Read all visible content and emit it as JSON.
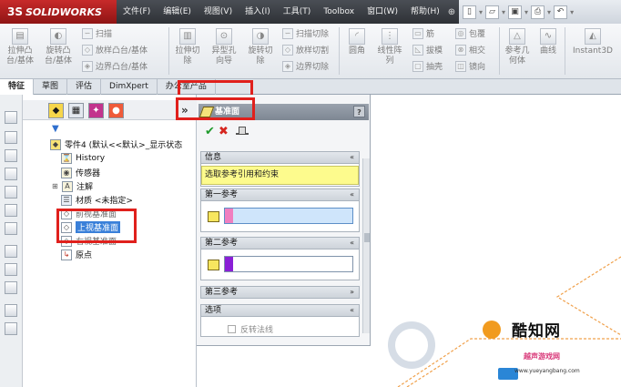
{
  "app": {
    "logo_text": "SOLIDWORKS",
    "logo_mark": "3S"
  },
  "menu": [
    "文件(F)",
    "编辑(E)",
    "视图(V)",
    "插入(I)",
    "工具(T)",
    "Toolbox",
    "窗口(W)",
    "帮助(H)"
  ],
  "command_manager": {
    "boss_extrude": "拉伸凸\n台/基体",
    "revolve_boss": "旋转凸\n台/基体",
    "sweep": "扫描",
    "loft_boss": "放样凸台/基体",
    "boundary_boss": "边界凸台/基体",
    "extrude_cut": "拉伸切\n除",
    "hole_wizard": "异型孔\n向导",
    "revolve_cut": "旋转切\n除",
    "swept_cut": "扫描切除",
    "lofted_cut": "放样切割",
    "boundary_cut": "边界切除",
    "fillet": "圆角",
    "linear_pattern": "线性阵\n列",
    "rib": "筋",
    "draft": "拔模",
    "shell": "抽壳",
    "wrap": "包覆",
    "intersect": "相交",
    "mirror": "镜向",
    "ref_geometry": "参考几\n何体",
    "curves": "曲线",
    "instant3d": "Instant3D"
  },
  "tabs": [
    "特征",
    "草图",
    "评估",
    "DimXpert",
    "办公室产品"
  ],
  "active_tab": 0,
  "feature_tree": {
    "root": "零件4 (默认<<默认>_显示状态",
    "items": [
      {
        "label": "History",
        "icon": "history-icon"
      },
      {
        "label": "传感器",
        "icon": "sensor-icon"
      },
      {
        "label": "注解",
        "icon": "annotation-icon",
        "expandable": true
      },
      {
        "label": "材质 <未指定>",
        "icon": "material-icon"
      },
      {
        "label": "前视基准面",
        "icon": "plane-icon"
      },
      {
        "label": "上视基准面",
        "icon": "plane-icon",
        "selected": true
      },
      {
        "label": "右视基准面",
        "icon": "plane-icon"
      },
      {
        "label": "原点",
        "icon": "origin-icon"
      }
    ]
  },
  "property_manager": {
    "title": "基准面",
    "help": "?",
    "groups": {
      "message": {
        "title": "信息",
        "text": "选取参考引用和约束"
      },
      "first_ref": {
        "title": "第一参考",
        "chip_color": "#f07fc0"
      },
      "second_ref": {
        "title": "第二参考",
        "chip_color": "#8a1fd6"
      },
      "third_ref": {
        "title": "第三参考"
      },
      "options": {
        "title": "选项",
        "flip_normal": "反转法线"
      }
    }
  },
  "watermark": {
    "brand": "酷知网",
    "sub": "越声游戏网",
    "url": "www.yueyangbang.com"
  },
  "colors": {
    "highlight_red": "#e0201c",
    "selection_blue": "#3a80d9",
    "message_yellow": "#fdfb8d",
    "sketch_orange": "#f0a04a"
  }
}
